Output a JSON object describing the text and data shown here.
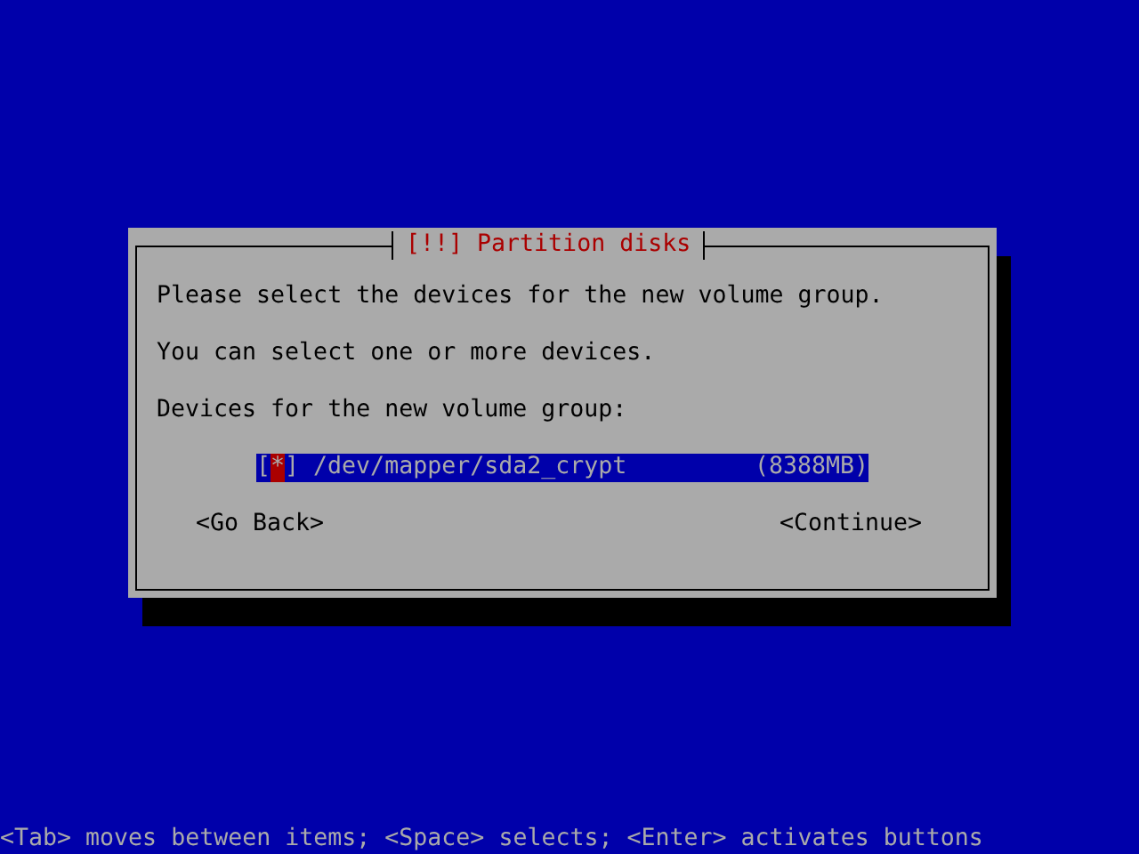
{
  "dialog": {
    "title": "[!!] Partition disks",
    "paragraphs": [
      "Please select the devices for the new volume group.",
      "You can select one or more devices."
    ],
    "list_label": "Devices for the new volume group:",
    "checkbox_left": "[",
    "check_mark": "*",
    "checkbox_right": "]",
    "devices": [
      {
        "name": "/dev/mapper/sda2_crypt",
        "size": "(8388MB)",
        "checked": true,
        "selected": true
      }
    ],
    "buttons": [
      {
        "label": "<Go Back>"
      },
      {
        "label": "<Continue>"
      }
    ]
  },
  "status_bar": "<Tab> moves between items; <Space> selects; <Enter> activates buttons"
}
